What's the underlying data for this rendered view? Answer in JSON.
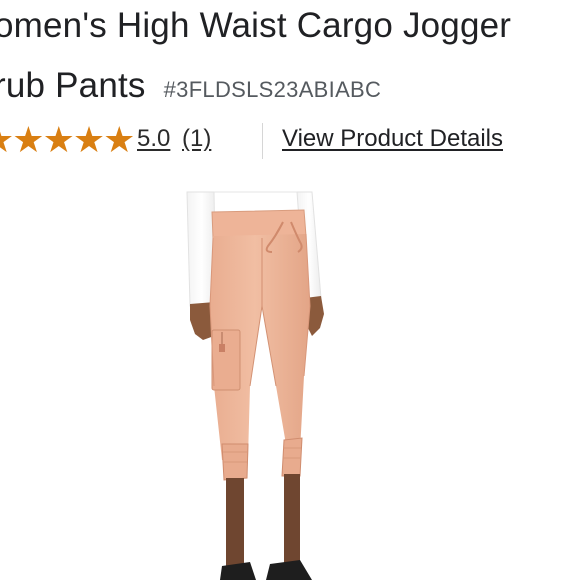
{
  "product": {
    "title_line1": "omen's High Waist Cargo Jogger",
    "title_line2": "rub Pants",
    "sku": "#3FLDSLS23ABIABC"
  },
  "rating": {
    "stars": 5,
    "star_icon": "star-icon",
    "value": "5.0",
    "count": "(1)"
  },
  "links": {
    "view_details": "View Product Details"
  },
  "image": {
    "subject": "model wearing jogger scrub pants",
    "colors": {
      "pants": "#eeb79b",
      "top": "#ffffff",
      "skin": "#8b5a3c",
      "shoes": "#1e1e1e",
      "star": "#d97f12"
    }
  }
}
